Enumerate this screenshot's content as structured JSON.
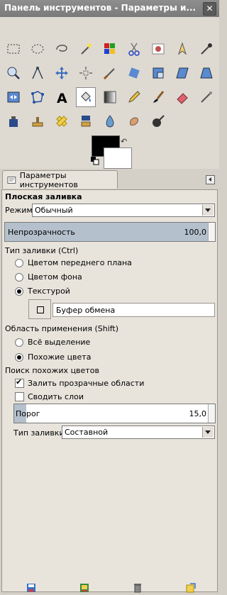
{
  "window": {
    "title": "Панель инструментов - Параметры и...",
    "close_label": "✕"
  },
  "tab": {
    "label": "Параметры инструментов"
  },
  "options": {
    "heading": "Плоская заливка",
    "mode_label": "Режим:",
    "mode_value": "Обычный",
    "opacity_label": "Непрозрачность",
    "opacity_value": "100,0",
    "fill_type_heading": "Тип заливки  (Ctrl)",
    "fill_fg": "Цветом переднего плана",
    "fill_bg": "Цветом фона",
    "fill_pattern": "Текстурой",
    "pattern_name": "Буфер обмена",
    "area_heading": "Область применения  (Shift)",
    "area_selection": "Всё выделение",
    "area_similar": "Похожие цвета",
    "similar_heading": "Поиск похожих цветов",
    "fill_transparent": "Залить прозрачные области",
    "merge_layers": "Сводить слои",
    "threshold_label": "Порог",
    "threshold_value": "15,0",
    "fill_by_label": "Тип заливки:",
    "fill_by_value": "Составной"
  },
  "state": {
    "fill_type_selected": "pattern",
    "area_selected": "similar",
    "fill_transparent_checked": true,
    "merge_layers_checked": false,
    "opacity_percent": 100,
    "threshold_fraction": 0.06
  },
  "colors": {
    "foreground": "#000000",
    "background": "#ffffff",
    "accent": "#b4c0cc"
  }
}
